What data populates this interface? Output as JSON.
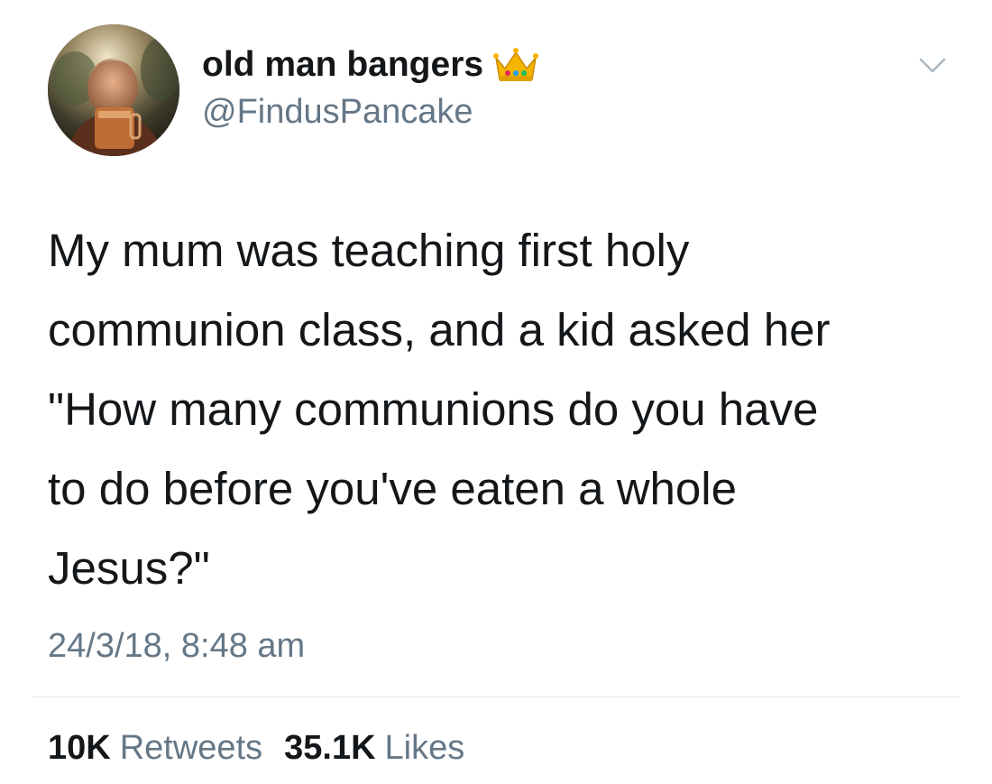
{
  "tweet": {
    "author": {
      "display_name": "old man bangers",
      "badge_icon": "crown-icon",
      "handle": "@FindusPancake",
      "avatar": "profile-photo"
    },
    "menu_icon": "chevron-down-icon",
    "text": "My mum was teaching first holy\ncommunion class, and a kid asked her\n\"How many communions do you have\nto do before you've eaten a whole\nJesus?\"",
    "timestamp": "24/3/18, 8:48 am",
    "stats": {
      "retweets_count": "10K",
      "retweets_label": "Retweets",
      "likes_count": "35.1K",
      "likes_label": "Likes"
    }
  },
  "colors": {
    "text_primary": "#14171a",
    "text_secondary": "#657786",
    "divider": "#e1e8ed",
    "crown_gold": "#f5b400"
  }
}
